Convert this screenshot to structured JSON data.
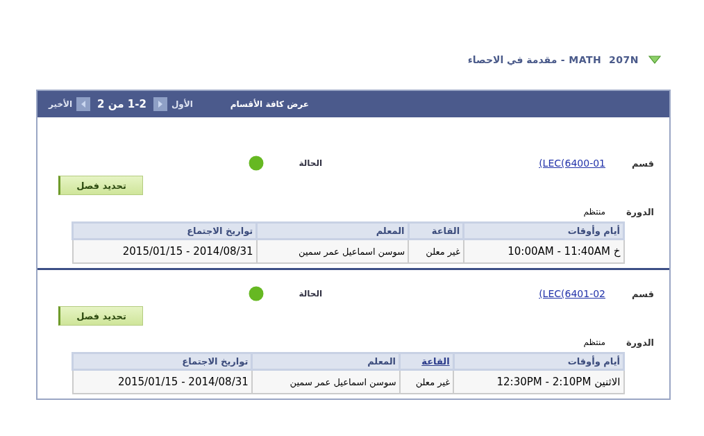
{
  "course_title": "MATH  207N - مقدمة في الاحصاء",
  "header": {
    "view_all": "عرض كافة الأقسام",
    "first": "الأول",
    "range": "1-2 من 2",
    "last": "الأخير"
  },
  "sections": [
    {
      "section_label": "قسم",
      "section_link": "(LEC(6400-01",
      "status_label": "الحالة",
      "select_button": "تحديد فصل",
      "session_label": "الدورة",
      "session_value": "منتظم",
      "columns": [
        {
          "label": "أيام وأوقات",
          "link": false
        },
        {
          "label": "القاعة",
          "link": false
        },
        {
          "label": "المعلم",
          "link": false
        },
        {
          "label": "تواريخ الاجتماع",
          "link": false
        }
      ],
      "rows": [
        [
          "خ 10:00AM - 11:40AM",
          "غير معلن",
          "سوسن اسماعيل عمر سمين",
          "2014/08/31 - 2015/01/15"
        ]
      ]
    },
    {
      "section_label": "قسم",
      "section_link": "(LEC(6401-02",
      "status_label": "الحالة",
      "select_button": "تحديد فصل",
      "session_label": "الدورة",
      "session_value": "منتظم",
      "columns": [
        {
          "label": "أيام وأوقات",
          "link": false
        },
        {
          "label": "القاعة",
          "link": true
        },
        {
          "label": "المعلم",
          "link": false
        },
        {
          "label": "تواريخ الاجتماع",
          "link": false
        }
      ],
      "rows": [
        [
          "الاثنين 12:30PM - 2:10PM",
          "غير معلن",
          "سوسن اسماعيل عمر سمين",
          "2014/08/31 - 2015/01/15"
        ]
      ]
    }
  ]
}
